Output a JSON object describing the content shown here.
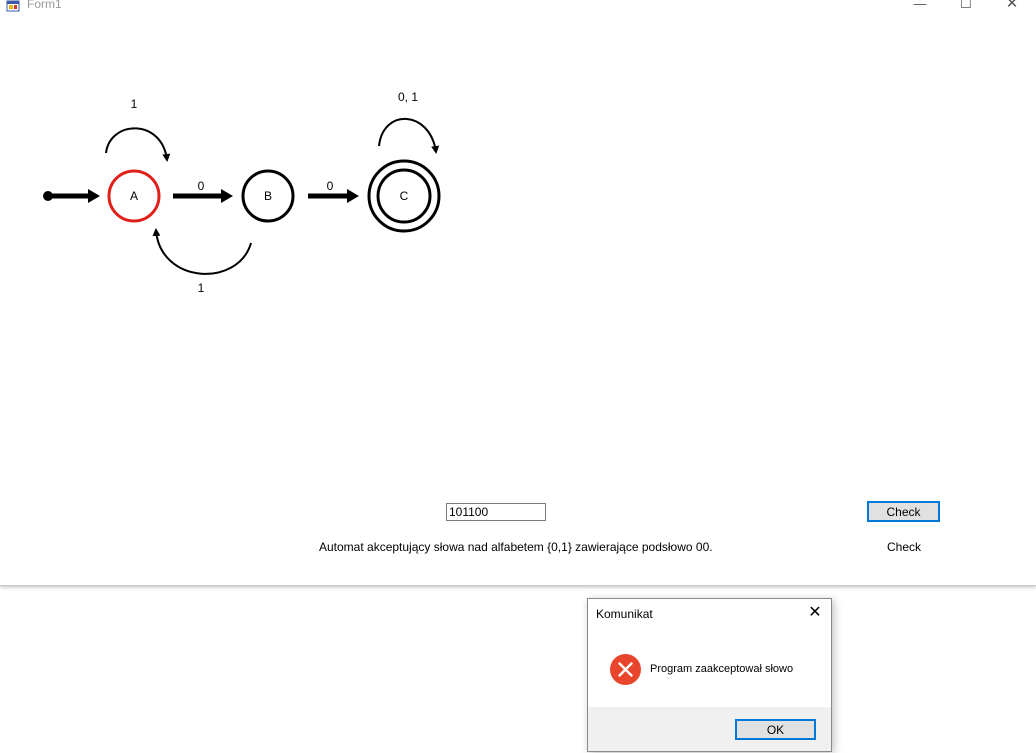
{
  "window": {
    "title": "Form1",
    "minimize_glyph": "—",
    "maximize_glyph": "☐",
    "close_glyph": "✕"
  },
  "automaton": {
    "states": [
      {
        "id": "A",
        "label": "A",
        "start": true,
        "accepting": false,
        "highlighted": true
      },
      {
        "id": "B",
        "label": "B",
        "start": false,
        "accepting": false,
        "highlighted": false
      },
      {
        "id": "C",
        "label": "C",
        "start": false,
        "accepting": true,
        "highlighted": false
      }
    ],
    "transitions": [
      {
        "from": "A",
        "to": "A",
        "label": "1"
      },
      {
        "from": "A",
        "to": "B",
        "label": "0"
      },
      {
        "from": "B",
        "to": "A",
        "label": "1"
      },
      {
        "from": "B",
        "to": "C",
        "label": "0"
      },
      {
        "from": "C",
        "to": "C",
        "label": "0, 1"
      }
    ],
    "colors": {
      "highlight": "#e0201b",
      "stroke": "#000000"
    }
  },
  "form": {
    "input_value": "101100",
    "check_button_label": "Check",
    "description": "Automat akceptujący słowa nad alfabetem {0,1} zawierające podsłowo 00.",
    "check_label": "Check"
  },
  "dialog": {
    "title": "Komunikat",
    "close_glyph": "✕",
    "icon": "error-icon",
    "message": "Program zaakceptował słowo",
    "ok_label": "OK"
  },
  "colors": {
    "accent": "#0078d7",
    "error": "#e8462c",
    "button_bg": "#e1e1e1"
  }
}
